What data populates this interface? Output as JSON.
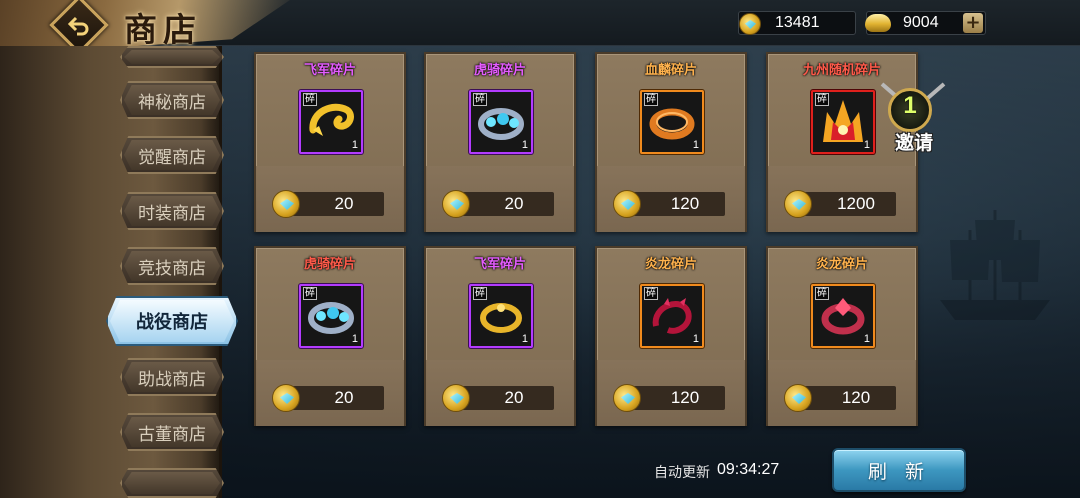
{
  "header": {
    "title": "商店"
  },
  "currencies": {
    "gems": "13481",
    "gold": "9004"
  },
  "sidebar": {
    "tabs": [
      {
        "label": "神秘商店"
      },
      {
        "label": "觉醒商店"
      },
      {
        "label": "时装商店"
      },
      {
        "label": "竞技商店"
      },
      {
        "label": "战役商店",
        "active": true
      },
      {
        "label": "助战商店"
      },
      {
        "label": "古董商店"
      }
    ]
  },
  "shop": {
    "items": [
      {
        "name": "飞军碎片",
        "frag_label": "碎",
        "qty": "1",
        "price": "20",
        "rarity": "purple",
        "icon": "hook-ring-icon"
      },
      {
        "name": "虎骑碎片",
        "frag_label": "碎",
        "qty": "1",
        "price": "20",
        "rarity": "purple",
        "icon": "jewel-ring-icon"
      },
      {
        "name": "血麟碎片",
        "frag_label": "碎",
        "qty": "1",
        "price": "120",
        "rarity": "orange",
        "icon": "bangle-icon"
      },
      {
        "name": "九州随机碎片",
        "frag_label": "碎",
        "qty": "1",
        "price": "1200",
        "rarity": "red",
        "icon": "flame-crest-icon"
      },
      {
        "name": "虎骑碎片",
        "frag_label": "碎",
        "qty": "1",
        "price": "20",
        "rarity": "purple",
        "icon": "jewel-ring-icon"
      },
      {
        "name": "飞军碎片",
        "frag_label": "碎",
        "qty": "1",
        "price": "20",
        "rarity": "purple",
        "icon": "gold-ring-icon"
      },
      {
        "name": "炎龙碎片",
        "frag_label": "碎",
        "qty": "1",
        "price": "120",
        "rarity": "orange",
        "icon": "dragon-ring-icon"
      },
      {
        "name": "炎龙碎片",
        "frag_label": "碎",
        "qty": "1",
        "price": "120",
        "rarity": "orange",
        "icon": "dragon-gem-ring-icon"
      }
    ]
  },
  "invite": {
    "count": "1",
    "label": "邀请"
  },
  "footer": {
    "auto_refresh_label": "自动更新",
    "auto_refresh_time": "09:34:27",
    "refresh_button": "刷 新"
  },
  "colors": {
    "purple": "#b33bff",
    "orange": "#f08a1d",
    "red": "#e0201c",
    "active_tab": "#a7d4f0"
  }
}
